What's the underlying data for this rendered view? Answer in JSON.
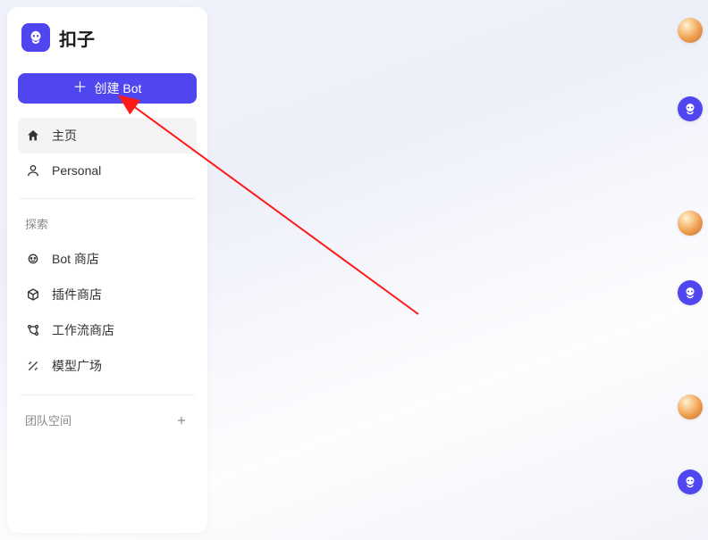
{
  "brand": {
    "name": "扣子"
  },
  "sidebar": {
    "create_label": "创建 Bot",
    "nav": [
      {
        "label": "主页"
      },
      {
        "label": "Personal"
      }
    ],
    "explore_label": "探索",
    "explore": [
      {
        "label": "Bot 商店"
      },
      {
        "label": "插件商店"
      },
      {
        "label": "工作流商店"
      },
      {
        "label": "模型广场"
      }
    ],
    "team_label": "团队空间"
  }
}
